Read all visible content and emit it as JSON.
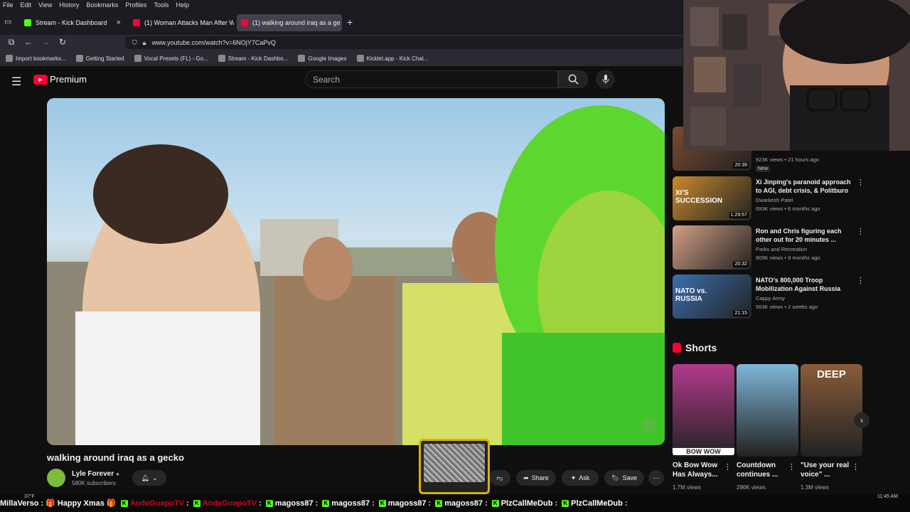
{
  "menubar": [
    "File",
    "Edit",
    "View",
    "History",
    "Bookmarks",
    "Profiles",
    "Tools",
    "Help"
  ],
  "tabs": [
    {
      "label": "Stream - Kick Dashboard",
      "icon": "kick-icon",
      "color": "#53fc18"
    },
    {
      "label": "(1) Woman Attacks Man After W",
      "icon": "youtube-icon",
      "color": "#ff0033"
    },
    {
      "label": "(1) walking around iraq as a ge",
      "icon": "youtube-icon",
      "color": "#ff0033",
      "active": true
    }
  ],
  "new_tab": "+",
  "url": "www.youtube.com/watch?v=6NOjY7CaPvQ",
  "bookmarks": [
    "Import bookmarks...",
    "Getting Started",
    "Vocal Presets (FL) - Go...",
    "Stream - Kick Dashbo...",
    "Google Images",
    "Kicklet.app - Kick Chat..."
  ],
  "yt": {
    "brand": "Premium",
    "search_placeholder": "Search"
  },
  "video": {
    "title": "walking around iraq as a gecko",
    "channel": "Lyle Forever",
    "subscribers": "580K subscribers"
  },
  "actions": {
    "share": "Share",
    "ask": "Ask",
    "save": "Save",
    "more": "⋯"
  },
  "recs": [
    {
      "title": "",
      "channel": "",
      "views": "923K views • 21 hours ago",
      "badge": "New",
      "duration": "20:39",
      "color": "#7a4a30"
    },
    {
      "title": "Xi Jinping's paranoid approach to AGI, debt crisis, & Politburo ...",
      "channel": "Dwarkesh Patel",
      "views": "693K views • 6 months ago",
      "duration": "1:29:57",
      "color": "#c98a2c",
      "thumb_text": "XI'S SUCCESSION"
    },
    {
      "title": "Ron and Chris figuring each other out for 20 minutes ...",
      "channel": "Parks and Recreation",
      "views": "909K views • 9 months ago",
      "duration": "20:32",
      "color": "#d3a184",
      "thumb_text": ""
    },
    {
      "title": "NATO's 800,000 Troop Mobilization Against Russia",
      "channel": "Cappy Army",
      "views": "563K views • 2 weeks ago",
      "duration": "21:15",
      "color": "#3b6fb0",
      "thumb_text": "NATO vs. RUSSIA"
    }
  ],
  "shorts_label": "Shorts",
  "shorts": [
    {
      "title": "Ok Bow Wow Has Always...",
      "views": "1.7M views",
      "thumb_text": "BOW WOW",
      "color": "#b23a8c"
    },
    {
      "title": "Countdown continues ...",
      "views": "296K views",
      "thumb_text": "",
      "color": "#7fb6d8"
    },
    {
      "title": "\"Use your real voice\" ...",
      "views": "1.3M views",
      "thumb_text": "DEEP",
      "color": "#8a5c3a"
    }
  ],
  "ticker": [
    {
      "user": "MillaVerso",
      "msg": "🎁 Happy Xmas 🎁",
      "color": "#ffffff"
    },
    {
      "user": "AndeGuapoTV",
      "msg": "",
      "color": "#d0021b"
    },
    {
      "user": "AndeGuapoTV",
      "msg": "",
      "color": "#d0021b"
    },
    {
      "user": "magoss87",
      "msg": "",
      "color": "#ffffff"
    },
    {
      "user": "magoss87",
      "msg": "",
      "color": "#ffffff"
    },
    {
      "user": "magoss87",
      "msg": "",
      "color": "#ffffff"
    },
    {
      "user": "magoss87",
      "msg": "",
      "color": "#ffffff"
    },
    {
      "user": "PlzCallMeDub",
      "msg": "",
      "color": "#ffffff"
    },
    {
      "user": "PlzCallMeDub",
      "msg": "",
      "color": "#ffffff"
    }
  ],
  "tray": {
    "temp": "37°F",
    "time": "11:45 AM"
  }
}
